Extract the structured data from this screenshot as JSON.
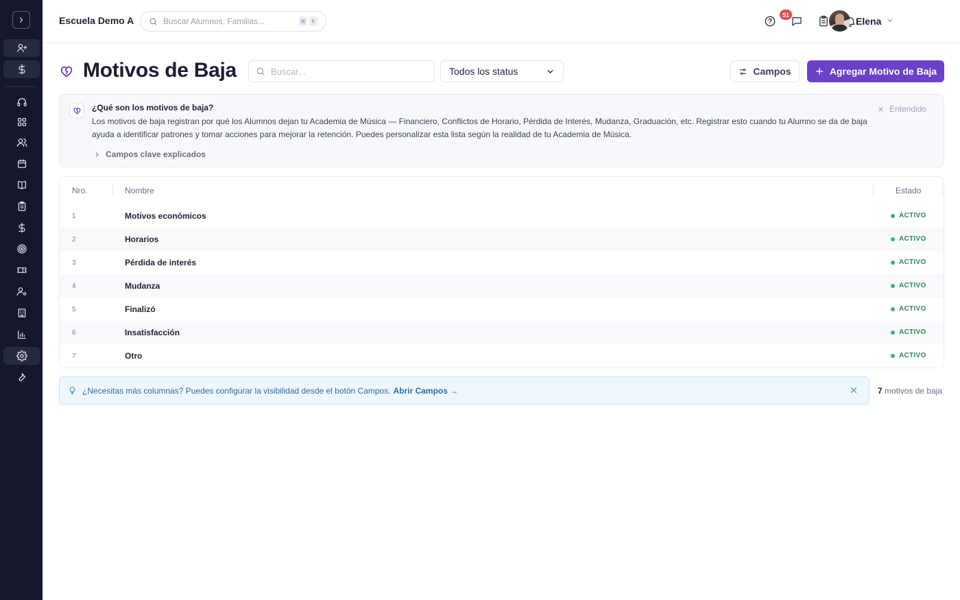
{
  "app": {
    "school_name": "Escuela Demo A",
    "user_name": "Elena",
    "notification_count": "51"
  },
  "global_search": {
    "placeholder": "Buscar Alumnos, Familias...",
    "shortcut_mod": "⌘",
    "shortcut_key": "K"
  },
  "sidebar": {
    "icons": [
      "user-plus-icon",
      "dollar-icon",
      "headset-icon",
      "dashboard-icon",
      "users-icon",
      "calendar-icon",
      "book-icon",
      "clipboard-icon",
      "billing-dollar-icon",
      "target-icon",
      "ticket-icon",
      "user-settings-icon",
      "building-icon",
      "bar-chart-icon",
      "settings-icon",
      "wrench-icon"
    ],
    "active": "settings-icon"
  },
  "page": {
    "title": "Motivos de Baja",
    "search_placeholder": "Buscar...",
    "status_filter": "Todos los status",
    "campos_label": "Campos",
    "add_label": "Agregar Motivo de Baja"
  },
  "info": {
    "title": "¿Qué son los motivos de baja?",
    "text": "Los motivos de baja registran por qué los Alumnos dejan tu Academia de Música — Financiero, Conflictos de Horario, Pérdida de Interés, Mudanza, Graduación, etc. Registrar esto cuando tu Alumno se da de baja ayuda a identificar patrones y tomar acciones para mejorar la retención. Puedes personalizar esta lista según la realidad de tu Academia de Música.",
    "dismiss": "Entendido",
    "key_fields": "Campos clave explicados"
  },
  "table": {
    "headers": {
      "num": "Nro.",
      "name": "Nombre",
      "status": "Estado"
    },
    "rows": [
      {
        "num": "1",
        "name": "Motivos económicos",
        "status": "ACTIVO"
      },
      {
        "num": "2",
        "name": "Horarios",
        "status": "ACTIVO"
      },
      {
        "num": "3",
        "name": "Pérdida de interés",
        "status": "ACTIVO"
      },
      {
        "num": "4",
        "name": "Mudanza",
        "status": "ACTIVO"
      },
      {
        "num": "5",
        "name": "Finalizó",
        "status": "ACTIVO"
      },
      {
        "num": "6",
        "name": "Insatisfacción",
        "status": "ACTIVO"
      },
      {
        "num": "7",
        "name": "Otro",
        "status": "ACTIVO"
      }
    ]
  },
  "tip": {
    "text": "¿Necesitas más columnas? Puedes configurar la visibilidad desde el botón Campos.",
    "link": "Abrir Campos →"
  },
  "footer": {
    "count": "7",
    "count_label": "motivos de baja"
  },
  "colors": {
    "sidebar_bg": "#15182d",
    "accent": "#6a41c9",
    "status_green": "#2f8a55",
    "tip_bg": "#edf7fd"
  }
}
